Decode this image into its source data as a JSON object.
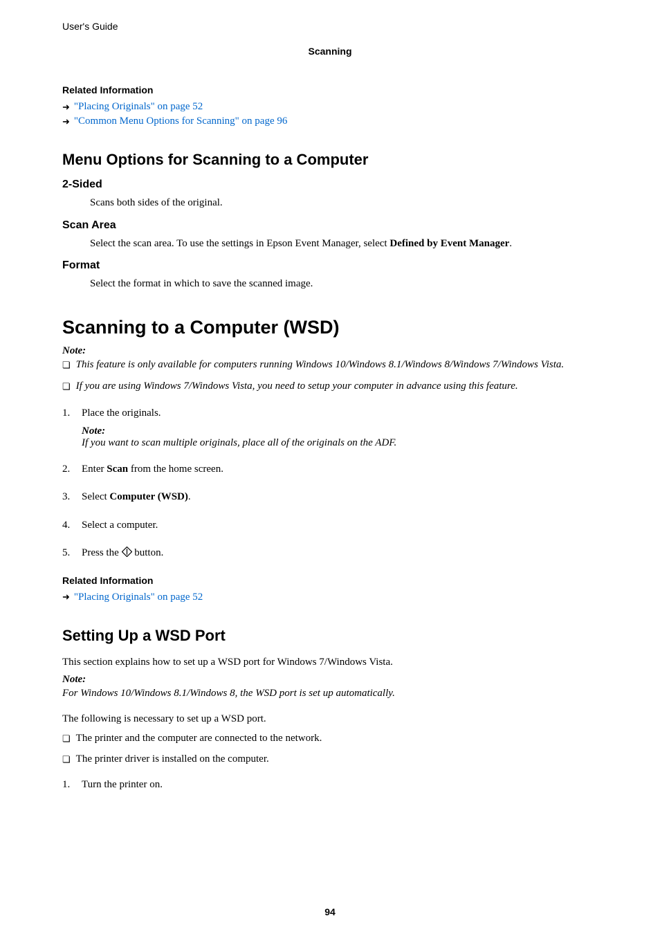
{
  "header": {
    "guide_title": "User's Guide",
    "chapter": "Scanning"
  },
  "related1": {
    "heading": "Related Information",
    "links": [
      "\"Placing Originals\" on page 52",
      "\"Common Menu Options for Scanning\" on page 96"
    ]
  },
  "menu_options": {
    "title": "Menu Options for Scanning to a Computer",
    "items": [
      {
        "name": "2-Sided",
        "desc": "Scans both sides of the original."
      },
      {
        "name": "Scan Area",
        "desc_pre": "Select the scan area. To use the settings in Epson Event Manager, select ",
        "desc_bold": "Defined by Event Manager",
        "desc_post": "."
      },
      {
        "name": "Format",
        "desc": "Select the format in which to save the scanned image."
      }
    ]
  },
  "wsd": {
    "title": "Scanning to a Computer (WSD)",
    "note_label": "Note:",
    "note_items": [
      "This feature is only available for computers running Windows 10/Windows 8.1/Windows 8/Windows 7/Windows Vista.",
      "If you are using Windows 7/Windows Vista, you need to setup your computer in advance using this feature."
    ],
    "steps": [
      {
        "num": "1.",
        "text": "Place the originals.",
        "has_note": true,
        "note_label": "Note:",
        "note_body": "If you want to scan multiple originals, place all of the originals on the ADF."
      },
      {
        "num": "2.",
        "text_pre": "Enter ",
        "text_bold": "Scan",
        "text_post": " from the home screen."
      },
      {
        "num": "3.",
        "text_pre": "Select ",
        "text_bold": "Computer (WSD)",
        "text_post": "."
      },
      {
        "num": "4.",
        "text": "Select a computer."
      },
      {
        "num": "5.",
        "text_pre": "Press the ",
        "text_post": " button.",
        "has_icon": true
      }
    ]
  },
  "related2": {
    "heading": "Related Information",
    "links": [
      "\"Placing Originals\" on page 52"
    ]
  },
  "wsd_port": {
    "title": "Setting Up a WSD Port",
    "intro": "This section explains how to set up a WSD port for Windows 7/Windows Vista.",
    "note_label": "Note:",
    "note_body": "For Windows 10/Windows 8.1/Windows 8, the WSD port is set up automatically.",
    "req_intro": "The following is necessary to set up a WSD port.",
    "req_items": [
      "The printer and the computer are connected to the network.",
      "The printer driver is installed on the computer."
    ],
    "steps": [
      {
        "num": "1.",
        "text": "Turn the printer on."
      }
    ]
  },
  "page_number": "94"
}
